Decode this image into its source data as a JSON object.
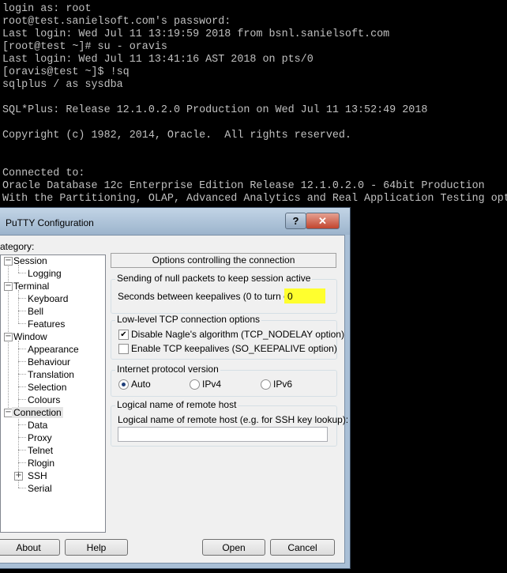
{
  "terminal": {
    "lines": [
      "login as: root",
      "root@test.sanielsoft.com's password:",
      "Last login: Wed Jul 11 13:19:59 2018 from bsnl.sanielsoft.com",
      "[root@test ~]# su - oravis",
      "Last login: Wed Jul 11 13:41:16 AST 2018 on pts/0",
      "[oravis@test ~]$ !sq",
      "sqlplus / as sysdba",
      "",
      "SQL*Plus: Release 12.1.0.2.0 Production on Wed Jul 11 13:52:49 2018",
      "",
      "Copyright (c) 1982, 2014, Oracle.  All rights reserved.",
      "",
      "",
      "Connected to:",
      "Oracle Database 12c Enterprise Edition Release 12.1.0.2.0 - 64bit Production",
      "With the Partitioning, OLAP, Advanced Analytics and Real Application Testing opt"
    ]
  },
  "dialog": {
    "title": "PuTTY Configuration",
    "help_glyph": "?",
    "close_glyph": "✕",
    "category_label": "ategory:",
    "tree": [
      {
        "label": "Session"
      },
      {
        "label": "Logging"
      },
      {
        "label": "Terminal"
      },
      {
        "label": "Keyboard"
      },
      {
        "label": "Bell"
      },
      {
        "label": "Features"
      },
      {
        "label": "Window"
      },
      {
        "label": "Appearance"
      },
      {
        "label": "Behaviour"
      },
      {
        "label": "Translation"
      },
      {
        "label": "Selection"
      },
      {
        "label": "Colours"
      },
      {
        "label": "Connection"
      },
      {
        "label": "Data"
      },
      {
        "label": "Proxy"
      },
      {
        "label": "Telnet"
      },
      {
        "label": "Rlogin"
      },
      {
        "label": "SSH"
      },
      {
        "label": "Serial"
      }
    ],
    "expand_glyph_collapsed": "+",
    "expand_glyph_expanded": "−",
    "panel": {
      "header": "Options controlling the connection",
      "null_packets": {
        "group_label": "Sending of null packets to keep session active",
        "keepalive_label": "Seconds between keepalives (0 to turn off)",
        "keepalive_value": "0"
      },
      "tcp": {
        "group_label": "Low-level TCP connection options",
        "nodelay_label": "Disable Nagle's algorithm (TCP_NODELAY option)",
        "nodelay_checked": "✔",
        "keepalive_label": "Enable TCP keepalives (SO_KEEPALIVE option)"
      },
      "ip": {
        "group_label": "Internet protocol version",
        "options": [
          "Auto",
          "IPv4",
          "IPv6"
        ],
        "selected": "Auto"
      },
      "host": {
        "group_label": "Logical name of remote host",
        "field_label": "Logical name of remote host (e.g. for SSH key lookup):",
        "value": ""
      }
    },
    "buttons": {
      "about": "About",
      "help": "Help",
      "open": "Open",
      "cancel": "Cancel"
    }
  }
}
